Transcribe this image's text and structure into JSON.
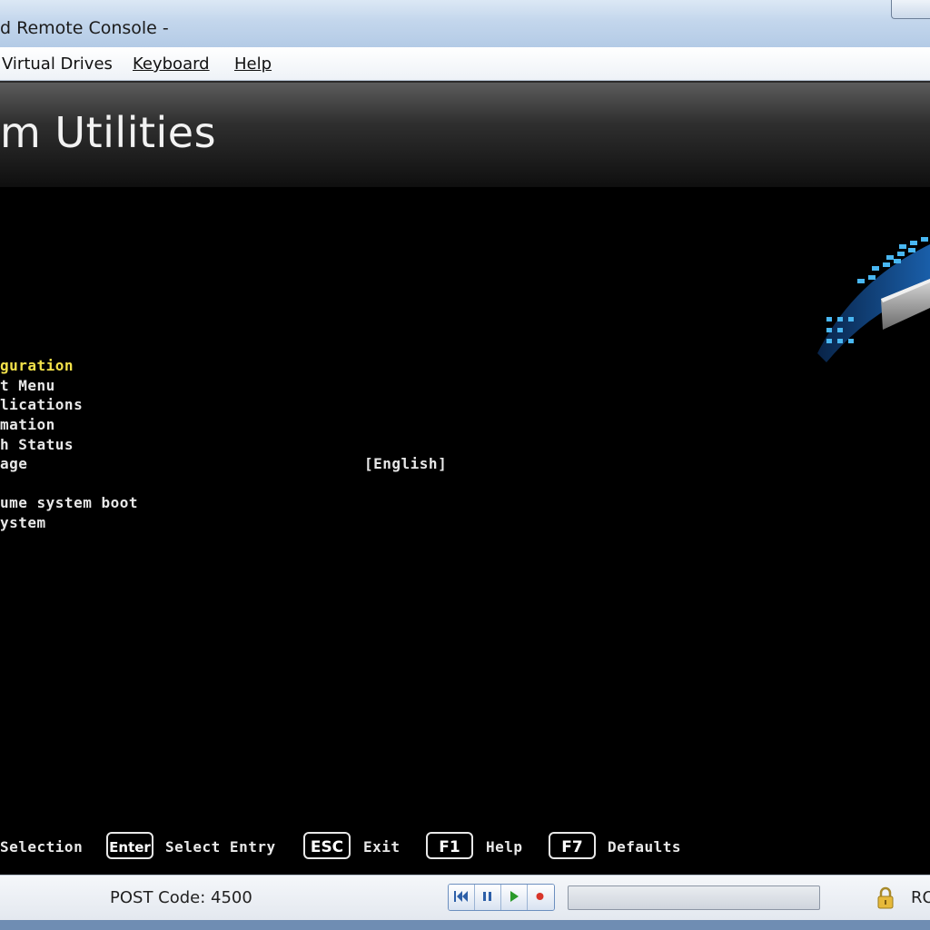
{
  "window": {
    "title": "d Remote Console -"
  },
  "menubar": {
    "items": [
      {
        "label": "Virtual Drives"
      },
      {
        "label": "Keyboard"
      },
      {
        "label": "Help"
      }
    ]
  },
  "console": {
    "banner_title": "m Utilities",
    "menu": [
      {
        "label": "guration",
        "selected": true
      },
      {
        "label": "t Menu",
        "selected": false
      },
      {
        "label": "lications",
        "selected": false
      },
      {
        "label": "mation",
        "selected": false
      },
      {
        "label": "h Status",
        "selected": false
      },
      {
        "label": "age",
        "selected": false,
        "value": "[English]"
      },
      {
        "label": "ume system boot",
        "selected": false
      },
      {
        "label": "ystem",
        "selected": false
      }
    ],
    "footer": {
      "selection_label": "Selection",
      "enter_key": "Enter",
      "enter_label": "Select Entry",
      "esc_key": "ESC",
      "esc_label": "Exit",
      "f1_key": "F1",
      "f1_label": "Help",
      "f7_key": "F7",
      "f7_label": "Defaults"
    }
  },
  "statusbar": {
    "post_code": "POST Code: 4500",
    "controls": [
      "skip-back-icon",
      "pause-icon",
      "play-icon",
      "record-icon"
    ],
    "progress": 0,
    "tail_text": "RO"
  },
  "colors": {
    "selected_text": "#f3e24a",
    "console_bg": "#000000",
    "frame": "#6f8db3"
  }
}
